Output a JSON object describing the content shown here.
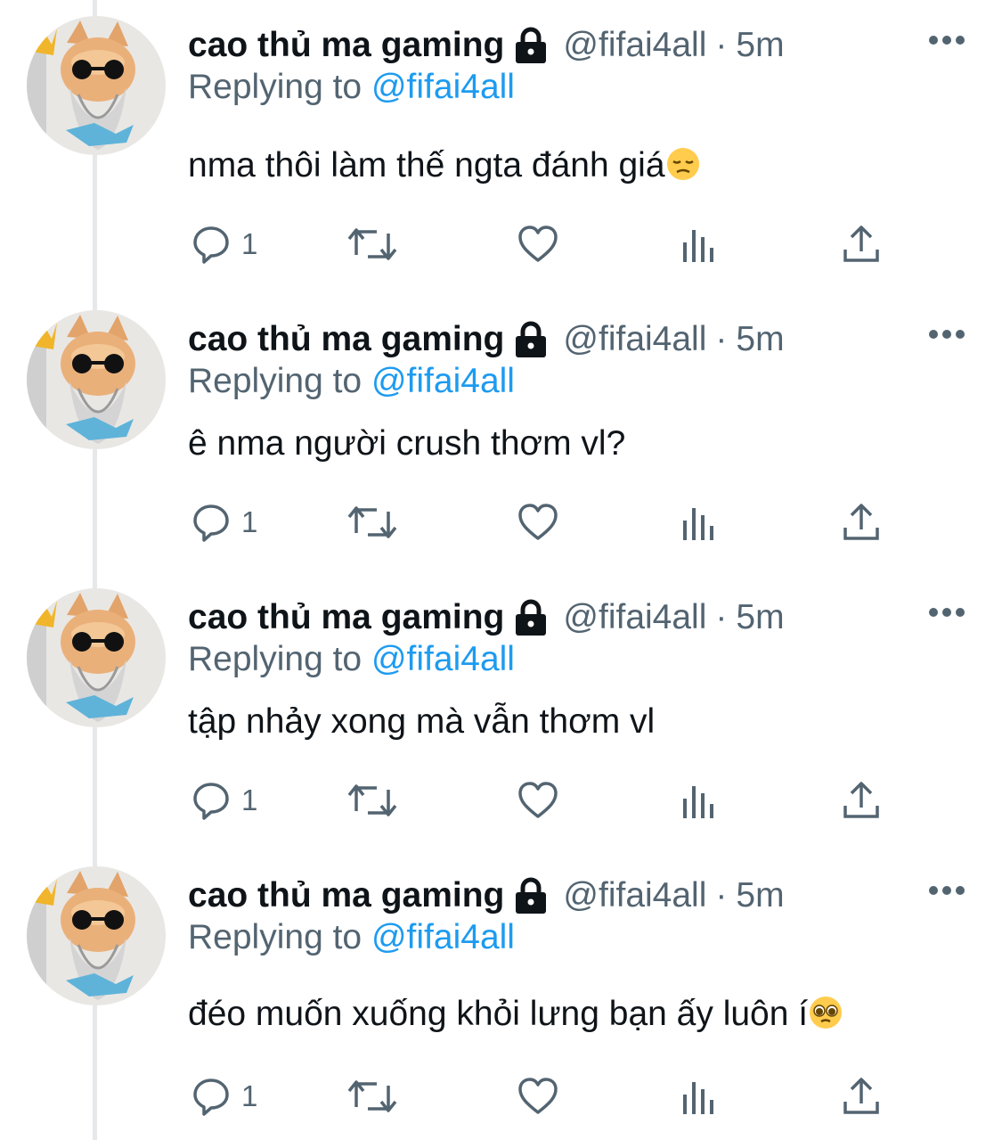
{
  "colors": {
    "accent": "#1d9bf0",
    "secondary_text": "#536471",
    "primary_text": "#0f1419",
    "thread_line": "#e6e8ea"
  },
  "tweets": [
    {
      "name": "cao thủ ma gaming",
      "handle": "@fifai4all",
      "dot": "·",
      "time": "5m",
      "replying_prefix": "Replying to",
      "replying_to": "@fifai4all",
      "text": "nma thôi làm thế ngta đánh giá",
      "emoji": "pensive-face",
      "reply_count": "1"
    },
    {
      "name": "cao thủ ma gaming",
      "handle": "@fifai4all",
      "dot": "·",
      "time": "5m",
      "replying_prefix": "Replying to",
      "replying_to": "@fifai4all",
      "text": "ê nma người crush thơm vl?",
      "emoji": "",
      "reply_count": "1"
    },
    {
      "name": "cao thủ ma gaming",
      "handle": "@fifai4all",
      "dot": "·",
      "time": "5m",
      "replying_prefix": "Replying to",
      "replying_to": "@fifai4all",
      "text": "tập nhảy xong mà vẫn thơm vl",
      "emoji": "",
      "reply_count": "1"
    },
    {
      "name": "cao thủ ma gaming",
      "handle": "@fifai4all",
      "dot": "·",
      "time": "5m",
      "replying_prefix": "Replying to",
      "replying_to": "@fifai4all",
      "text": "đéo muốn xuống khỏi lưng bạn ấy luôn í",
      "emoji": "pleading-face",
      "reply_count": "1"
    }
  ],
  "icons": {
    "lock": "lock-icon",
    "more": "more-icon",
    "reply": "reply-icon",
    "retweet": "retweet-icon",
    "like": "like-icon",
    "views": "views-icon",
    "share": "share-icon"
  }
}
